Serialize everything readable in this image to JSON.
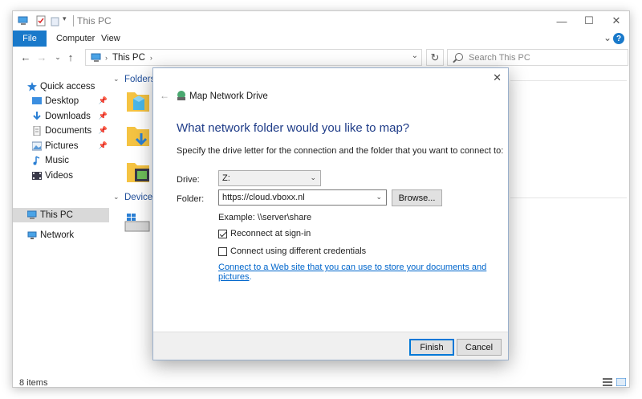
{
  "window": {
    "title": "This PC",
    "ribbon_tabs": [
      "File",
      "Computer",
      "View"
    ]
  },
  "nav": {
    "path": "This PC",
    "search_placeholder": "Search This PC"
  },
  "sidebar": {
    "items": [
      {
        "label": "Quick access",
        "icon": "star-icon"
      },
      {
        "label": "Desktop",
        "icon": "desktop-icon",
        "pinned": true
      },
      {
        "label": "Downloads",
        "icon": "download-icon",
        "pinned": true
      },
      {
        "label": "Documents",
        "icon": "document-icon",
        "pinned": true
      },
      {
        "label": "Pictures",
        "icon": "pictures-icon",
        "pinned": true
      },
      {
        "label": "Music",
        "icon": "music-icon"
      },
      {
        "label": "Videos",
        "icon": "videos-icon"
      },
      {
        "label": "This PC",
        "icon": "computer-icon",
        "selected": true
      },
      {
        "label": "Network",
        "icon": "network-icon"
      }
    ]
  },
  "content": {
    "sections": [
      "Folders (",
      "Devices a"
    ]
  },
  "status": {
    "item_count": "8 items"
  },
  "dialog": {
    "title": "Map Network Drive",
    "heading": "What network folder would you like to map?",
    "description": "Specify the drive letter for the connection and the folder that you want to connect to:",
    "drive_label": "Drive:",
    "drive_value": "Z:",
    "folder_label": "Folder:",
    "folder_value": "https://cloud.vboxx.nl",
    "browse_label": "Browse...",
    "example": "Example: \\\\server\\share",
    "reconnect_label": "Reconnect at sign-in",
    "reconnect_checked": true,
    "credentials_label": "Connect using different credentials",
    "credentials_checked": false,
    "link_text": "Connect to a Web site that you can use to store your documents and pictures",
    "link_suffix": ".",
    "finish_label": "Finish",
    "cancel_label": "Cancel"
  },
  "colors": {
    "accent": "#1979ca",
    "heading": "#1f3c88",
    "link": "#0066cc"
  }
}
